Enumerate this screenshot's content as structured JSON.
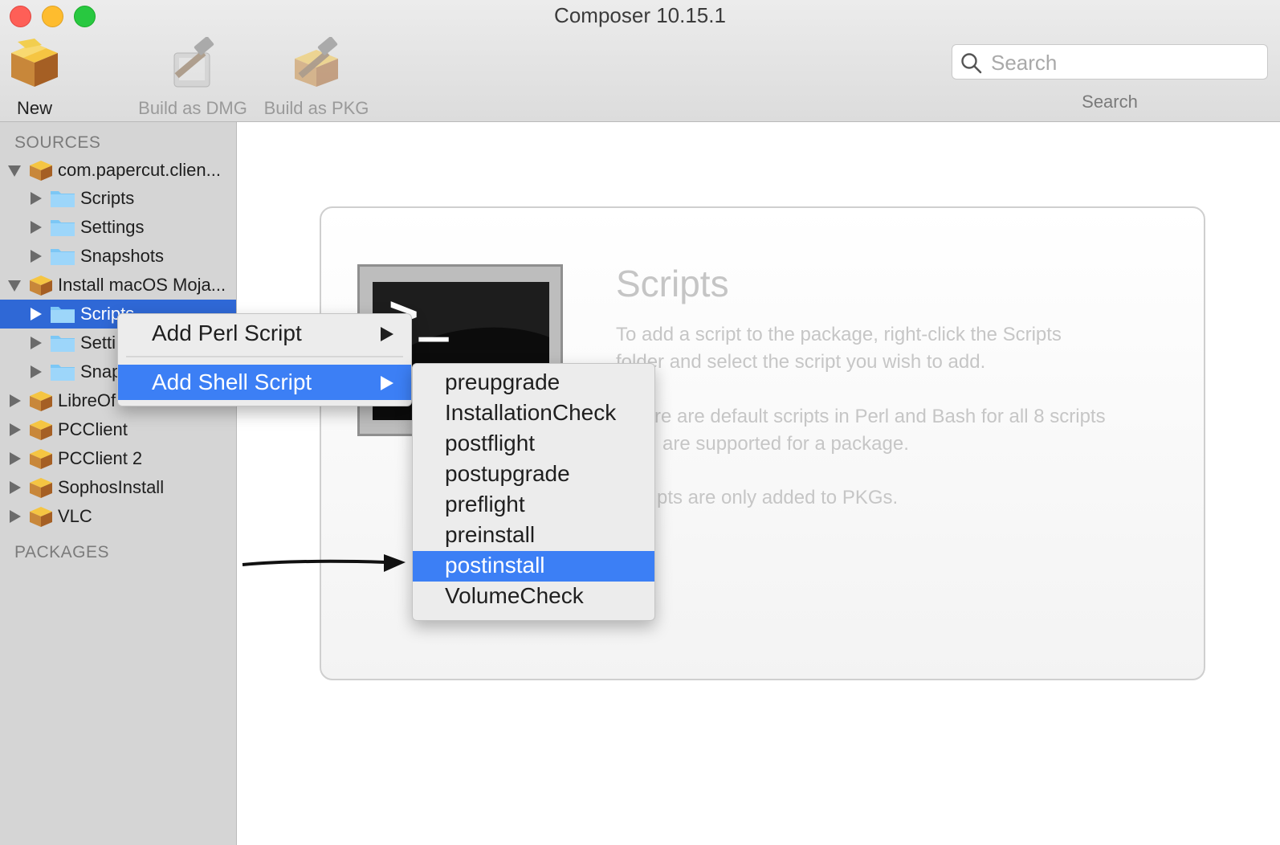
{
  "window": {
    "title": "Composer 10.15.1"
  },
  "toolbar": {
    "new_label": "New",
    "build_dmg_label": "Build as DMG",
    "build_pkg_label": "Build as PKG",
    "search_placeholder": "Search",
    "search_label": "Search"
  },
  "sidebar": {
    "sources_heading": "SOURCES",
    "packages_heading": "PACKAGES",
    "sources": [
      {
        "label": "com.papercut.clien...",
        "children": [
          "Scripts",
          "Settings",
          "Snapshots"
        ]
      },
      {
        "label": "Install macOS Moja...",
        "children": [
          "Scripts",
          "Setti",
          "Snap"
        ]
      },
      {
        "label": "LibreOf"
      },
      {
        "label": "PCClient"
      },
      {
        "label": "PCClient 2"
      },
      {
        "label": "SophosInstall"
      },
      {
        "label": "VLC"
      }
    ],
    "selected_item": "Install macOS Moja... / Scripts"
  },
  "main": {
    "title": "Scripts",
    "line1": "To add a script to the package, right-click the Scripts",
    "line2": "folder and select the script you wish to add.",
    "line3": "re are default scripts in Perl and Bash for all 8 scripts",
    "line4": "are supported for a package.",
    "line5": "pts are only added to PKGs.",
    "terminal_prompt": ">_"
  },
  "context_menu": {
    "items": [
      "Add Perl Script",
      "Add Shell Script"
    ],
    "highlighted": "Add Shell Script"
  },
  "submenu": {
    "items": [
      "preupgrade",
      "InstallationCheck",
      "postflight",
      "postupgrade",
      "preflight",
      "preinstall",
      "postinstall",
      "VolumeCheck"
    ],
    "highlighted": "postinstall"
  },
  "colors": {
    "selection": "#2f68d6",
    "menu_highlight": "#3c7ff5",
    "close": "#fe5f57",
    "minimize": "#febc2e",
    "maximize": "#28c840"
  }
}
